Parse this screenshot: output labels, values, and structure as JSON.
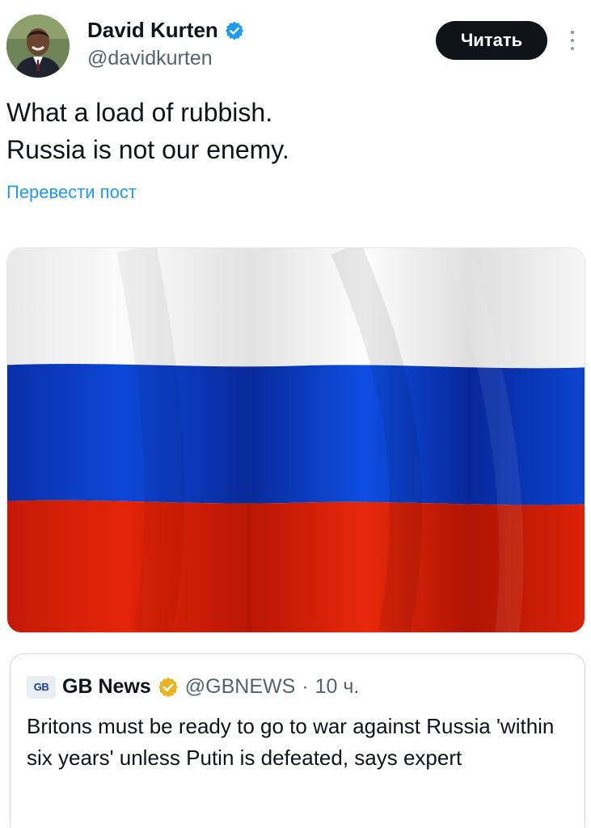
{
  "author": {
    "name": "David Kurten",
    "handle": "@davidkurten",
    "verified_color": "#1d9bf0"
  },
  "follow_button_label": "Читать",
  "tweet": {
    "line1": "What a load of rubbish.",
    "line2": "Russia is not our enemy."
  },
  "translate_label": "Перевести пост",
  "media": {
    "subject": "russian-flag",
    "colors": [
      "#f4f4f4",
      "#0a3fc4",
      "#d81e05"
    ]
  },
  "quoted_post": {
    "logo_text": "GB",
    "name": "GB News",
    "handle": "@GBNEWS",
    "separator": "·",
    "time": "10 ч.",
    "badge_color": "#e8b422",
    "text": "Britons must be ready to go to war against Russia 'within six years' unless Putin is defeated, says expert"
  },
  "icons": {
    "verified": "verified-badge-icon",
    "more": "more-options-icon",
    "gold": "gold-verified-badge-icon"
  }
}
